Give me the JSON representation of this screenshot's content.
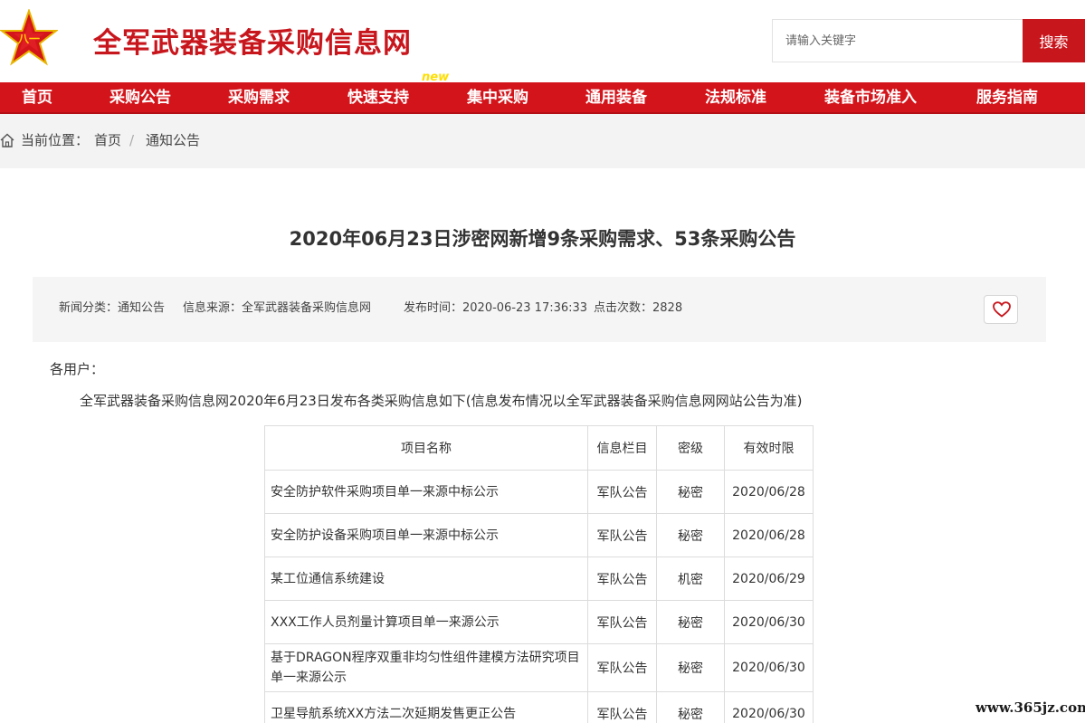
{
  "header": {
    "site_title": "全军武器装备采购信息网",
    "search_placeholder": "请输入关键字",
    "search_button": "搜索",
    "logo_icon": "red-star-emblem-icon",
    "logo_text": "八一"
  },
  "colors": {
    "brand_red": "#c8161d",
    "nav_red": "#d4141b",
    "new_badge": "#ffde00"
  },
  "nav": {
    "items": [
      {
        "label": "首页"
      },
      {
        "label": "采购公告"
      },
      {
        "label": "采购需求"
      },
      {
        "label": "快速支持",
        "badge": "new"
      },
      {
        "label": "集中采购"
      },
      {
        "label": "通用装备"
      },
      {
        "label": "法规标准"
      },
      {
        "label": "装备市场准入"
      },
      {
        "label": "服务指南"
      }
    ]
  },
  "breadcrumb": {
    "icon": "home-icon",
    "prefix": "当前位置：",
    "items": [
      "首页",
      "通知公告"
    ],
    "separator": "/"
  },
  "article": {
    "title": "2020年06月23日涉密网新增9条采购需求、53条采购公告",
    "meta": {
      "category": "新闻分类：通知公告",
      "source": "信息来源：全军武器装备采购信息网",
      "published": "发布时间：2020-06-23 17:36:33",
      "clicks": "点击次数：2828"
    },
    "favorite_icon": "heart-icon",
    "greeting": "各用户：",
    "intro": "全军武器装备采购信息网2020年6月23日发布各类采购信息如下(信息发布情况以全军武器装备采购信息网网站公告为准)"
  },
  "table": {
    "headers": [
      "项目名称",
      "信息栏目",
      "密级",
      "有效时限"
    ],
    "rows": [
      [
        "安全防护软件采购项目单一来源中标公示",
        "军队公告",
        "秘密",
        "2020/06/28"
      ],
      [
        "安全防护设备采购项目单一来源中标公示",
        "军队公告",
        "秘密",
        "2020/06/28"
      ],
      [
        "某工位通信系统建设",
        "军队公告",
        "机密",
        "2020/06/29"
      ],
      [
        "XXX工作人员剂量计算项目单一来源公示",
        "军队公告",
        "秘密",
        "2020/06/30"
      ],
      [
        "基于DRAGON程序双重非均匀性组件建模方法研究项目单一来源公示",
        "军队公告",
        "秘密",
        "2020/06/30"
      ],
      [
        "卫星导航系统XX方法二次延期发售更正公告",
        "军队公告",
        "秘密",
        "2020/06/30"
      ]
    ]
  },
  "watermark": "www.365jz.com"
}
